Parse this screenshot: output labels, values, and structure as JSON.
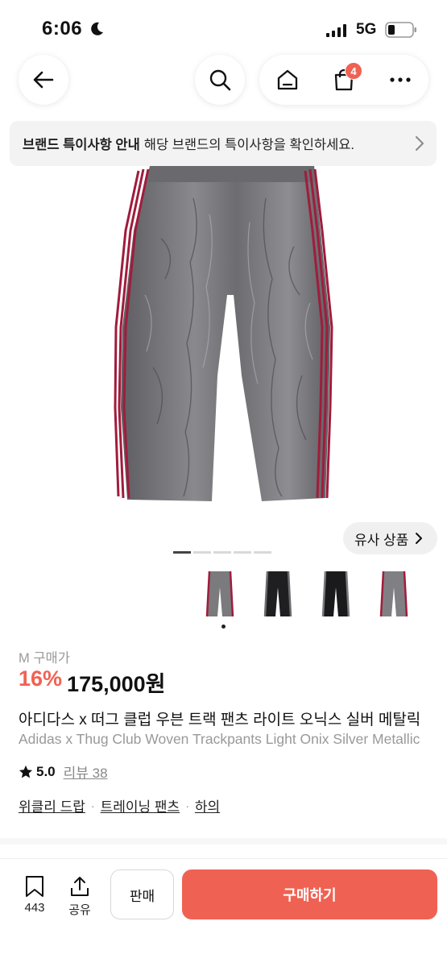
{
  "status_bar": {
    "time": "6:06",
    "network": "5G"
  },
  "nav": {
    "cart_count": "4"
  },
  "notice": {
    "bold_text": "브랜드 특이사항 안내",
    "text": "해당 브랜드의 특이사항을 확인하세요."
  },
  "gallery": {
    "similar_label": "유사 상품",
    "page_count": 5,
    "current_page": 1,
    "thumbnail_count": 4
  },
  "product": {
    "size_label": "M 구매가",
    "discount": "16%",
    "price": "175,000원",
    "title_ko": "아디다스 x 떠그 클럽 우븐 트랙 팬츠 라이트 오닉스 실버 메탈릭",
    "title_en": "Adidas x Thug Club Woven Trackpants Light Onix Silver Metallic",
    "rating": "5.0",
    "reviews": "리뷰 38",
    "categories": [
      "위클리 드랍",
      "트레이닝 팬츠",
      "하의"
    ]
  },
  "bottom_bar": {
    "save_count": "443",
    "share_label": "공유",
    "sell_label": "판매",
    "buy_label": "구매하기"
  },
  "colors": {
    "accent": "#ef6253",
    "pant_silver": "#7b7b7e",
    "stripe_red": "#a01c3c"
  }
}
